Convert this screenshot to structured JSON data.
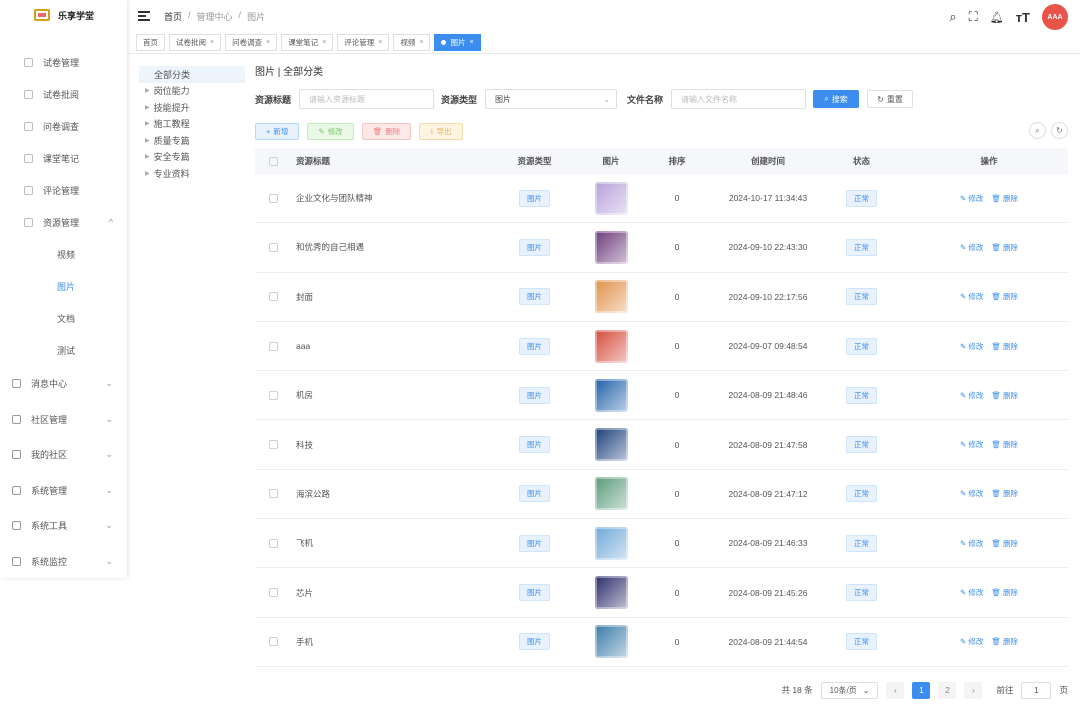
{
  "app": {
    "logo_text": "乐享学堂"
  },
  "sidebar": {
    "items": [
      {
        "label": "试卷管理",
        "level": "sub-icon"
      },
      {
        "label": "试卷批阅",
        "level": "sub-icon"
      },
      {
        "label": "问卷调查",
        "level": "sub-icon"
      },
      {
        "label": "课堂笔记",
        "level": "sub-icon"
      },
      {
        "label": "评论管理",
        "level": "sub-icon"
      },
      {
        "label": "资源管理",
        "level": "sub-icon",
        "chevron": "^"
      }
    ],
    "subitems": [
      {
        "label": "视频"
      },
      {
        "label": "图片",
        "active": true
      },
      {
        "label": "文档"
      },
      {
        "label": "测试"
      }
    ],
    "groups": [
      {
        "label": "消息中心",
        "chevron": "⌄"
      },
      {
        "label": "社区管理",
        "chevron": "⌄"
      },
      {
        "label": "我的社区",
        "chevron": "⌄"
      },
      {
        "label": "系统管理",
        "chevron": "⌄"
      },
      {
        "label": "系统工具",
        "chevron": "⌄"
      },
      {
        "label": "系统监控",
        "chevron": "⌄"
      }
    ]
  },
  "header": {
    "breadcrumb": [
      "首页",
      "/",
      "管理中心",
      "/",
      "图片"
    ],
    "avatar_text": "AAA"
  },
  "tabs": [
    {
      "label": "首页"
    },
    {
      "label": "试卷批阅"
    },
    {
      "label": "问卷调查"
    },
    {
      "label": "课堂笔记"
    },
    {
      "label": "评论管理"
    },
    {
      "label": "视频"
    },
    {
      "label": "图片",
      "active": true
    }
  ],
  "tree": {
    "root": "全部分类",
    "children": [
      "岗位能力",
      "技能提升",
      "施工教程",
      "质量专篇",
      "安全专篇",
      "专业资料"
    ]
  },
  "main": {
    "title": "图片 | 全部分类",
    "search": {
      "title_label": "资源标题",
      "title_placeholder": "请输入资源标题",
      "type_label": "资源类型",
      "type_value": "图片",
      "file_label": "文件名称",
      "file_placeholder": "请输入文件名称",
      "search_btn": "搜索",
      "reset_btn": "重置"
    },
    "toolbar": {
      "add": "新增",
      "edit": "修改",
      "delete": "删除",
      "export": "导出"
    }
  },
  "table": {
    "headers": [
      "资源标题",
      "资源类型",
      "图片",
      "排序",
      "创建时间",
      "状态",
      "操作"
    ],
    "rows": [
      {
        "title": "企业文化与团队精神",
        "type": "图片",
        "sort": "0",
        "time": "2024-10-17 11:34:43",
        "status": "正常",
        "edit": "修改",
        "del": "删除",
        "thumb_color": "#b5a0d8"
      },
      {
        "title": "和优秀的自己相遇",
        "type": "图片",
        "sort": "0",
        "time": "2024-09-10 22:43:30",
        "status": "正常",
        "edit": "修改",
        "del": "删除",
        "thumb_color": "#6b3a7a"
      },
      {
        "title": "封面",
        "type": "图片",
        "sort": "0",
        "time": "2024-09-10 22:17:56",
        "status": "正常",
        "edit": "修改",
        "del": "删除",
        "thumb_color": "#e0914a"
      },
      {
        "title": "aaa",
        "type": "图片",
        "sort": "0",
        "time": "2024-09-07 09:48:54",
        "status": "正常",
        "edit": "修改",
        "del": "删除",
        "thumb_color": "#d44a3a"
      },
      {
        "title": "机房",
        "type": "图片",
        "sort": "0",
        "time": "2024-08-09 21:48:46",
        "status": "正常",
        "edit": "修改",
        "del": "删除",
        "thumb_color": "#1f5fa8"
      },
      {
        "title": "科技",
        "type": "图片",
        "sort": "0",
        "time": "2024-08-09 21:47:58",
        "status": "正常",
        "edit": "修改",
        "del": "删除",
        "thumb_color": "#1a3e7a"
      },
      {
        "title": "海滨公路",
        "type": "图片",
        "sort": "0",
        "time": "2024-08-09 21:47:12",
        "status": "正常",
        "edit": "修改",
        "del": "删除",
        "thumb_color": "#5a9a7a"
      },
      {
        "title": "飞机",
        "type": "图片",
        "sort": "0",
        "time": "2024-08-09 21:46:33",
        "status": "正常",
        "edit": "修改",
        "del": "删除",
        "thumb_color": "#6fa8d8"
      },
      {
        "title": "芯片",
        "type": "图片",
        "sort": "0",
        "time": "2024-08-09 21:45:26",
        "status": "正常",
        "edit": "修改",
        "del": "删除",
        "thumb_color": "#2a2a6a"
      },
      {
        "title": "手机",
        "type": "图片",
        "sort": "0",
        "time": "2024-08-09 21:44:54",
        "status": "正常",
        "edit": "修改",
        "del": "删除",
        "thumb_color": "#3a7aa8"
      }
    ]
  },
  "pagination": {
    "total": "共 18 条",
    "size": "10条/页",
    "pages": [
      "1",
      "2"
    ],
    "goto_label": "前往",
    "goto_value": "1",
    "page_suffix": "页"
  },
  "colors": {
    "primary": "#3b8ef0",
    "avatar": "#e8534a"
  }
}
